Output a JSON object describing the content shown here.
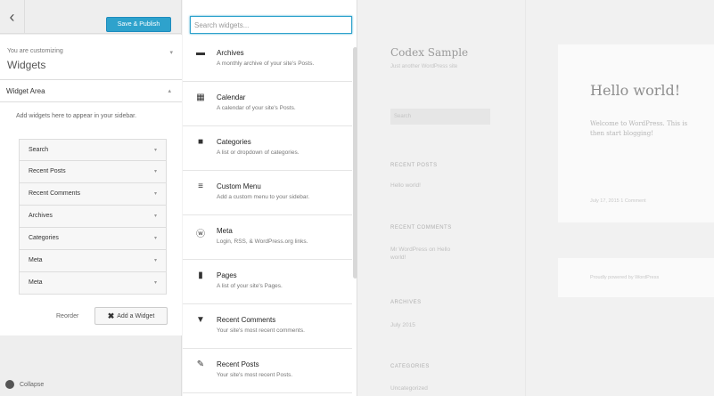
{
  "customizer": {
    "back_icon": "chevron-left-icon",
    "save_label": "Save & Publish",
    "customizing_label": "You are customizing",
    "section_title": "Widgets",
    "widget_area_title": "Widget Area",
    "widget_area_desc": "Add widgets here to appear in your sidebar.",
    "widgets": [
      {
        "name": "Search"
      },
      {
        "name": "Recent Posts"
      },
      {
        "name": "Recent Comments"
      },
      {
        "name": "Archives"
      },
      {
        "name": "Categories"
      },
      {
        "name": "Meta"
      },
      {
        "name": "Meta"
      }
    ],
    "reorder_label": "Reorder",
    "add_widget_label": "Add a Widget",
    "collapse_label": "Collapse"
  },
  "available_widgets": {
    "search_placeholder": "Search widgets...",
    "items": [
      {
        "icon": "archive-icon",
        "title": "Archives",
        "desc": "A monthly archive of your site's Posts."
      },
      {
        "icon": "calendar-icon",
        "title": "Calendar",
        "desc": "A calendar of your site's Posts."
      },
      {
        "icon": "folder-icon",
        "title": "Categories",
        "desc": "A list or dropdown of categories."
      },
      {
        "icon": "menu-icon",
        "title": "Custom Menu",
        "desc": "Add a custom menu to your sidebar."
      },
      {
        "icon": "wordpress-icon",
        "title": "Meta",
        "desc": "Login, RSS, & WordPress.org links."
      },
      {
        "icon": "pages-icon",
        "title": "Pages",
        "desc": "A list of your site's Pages."
      },
      {
        "icon": "comment-icon",
        "title": "Recent Comments",
        "desc": "Your site's most recent comments."
      },
      {
        "icon": "pin-icon",
        "title": "Recent Posts",
        "desc": "Your site's most recent Posts."
      }
    ]
  },
  "preview": {
    "site_title": "Codex Sample",
    "site_desc": "Just another WordPress site",
    "search_placeholder": "Search",
    "recent_posts_heading": "RECENT POSTS",
    "recent_posts_item": "Hello world!",
    "recent_comments_heading": "RECENT COMMENTS",
    "recent_comments_item": "Mr WordPress on Hello world!",
    "archives_heading": "ARCHIVES",
    "archives_item": "July 2015",
    "categories_heading": "CATEGORIES",
    "categories_item": "Uncategorized",
    "post_title": "Hello world!",
    "post_body_1": "Welcome to WordPress. This is",
    "post_body_2": "then start blogging!",
    "post_meta": "July 17, 2015   1 Comment",
    "footer_text": "Proudly powered by WordPress"
  }
}
